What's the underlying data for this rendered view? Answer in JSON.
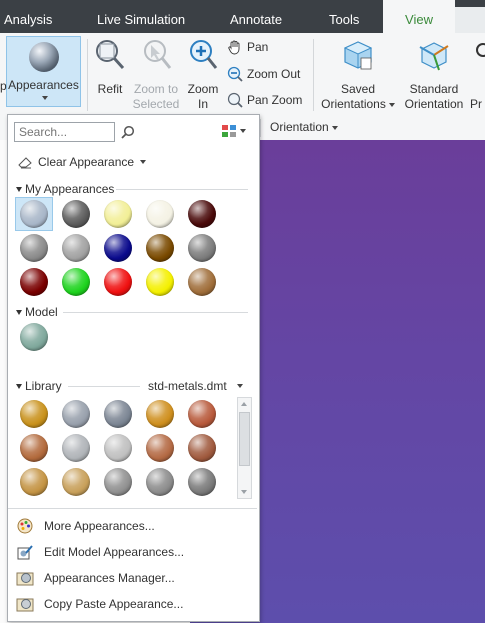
{
  "tabs": [
    {
      "label": "Analysis",
      "active": false
    },
    {
      "label": "Live Simulation",
      "active": false
    },
    {
      "label": "Annotate",
      "active": false
    },
    {
      "label": "Tools",
      "active": false
    },
    {
      "label": "View",
      "active": true
    }
  ],
  "ribbon": {
    "appearances_label": "Appearances",
    "refit_label": "Refit",
    "zoom_selected_line1": "Zoom to",
    "zoom_selected_line2": "Selected",
    "zoom_in_line1": "Zoom",
    "zoom_in_line2": "In",
    "pan_label": "Pan",
    "zoom_out_label": "Zoom Out",
    "pan_zoom_label": "Pan Zoom",
    "saved_orientations_line1": "Saved",
    "saved_orientations_line2": "Orientations",
    "standard_orientation_line1": "Standard",
    "standard_orientation_line2": "Orientation",
    "partial_left_button": "Pr",
    "partial_left_group": "p",
    "orientation_group_label": "Orientation"
  },
  "panel": {
    "search_placeholder": "Search...",
    "clear_appearance_label": "Clear Appearance",
    "my_appearances_title": "My Appearances",
    "model_title": "Model",
    "library_title": "Library",
    "library_source": "std-metals.dmt",
    "my_appearances_colors": [
      [
        "#a8b6c8",
        "#5c5c5c",
        "#f2ef96",
        "#f4f2e4",
        "#4a0a0a"
      ],
      [
        "#8a8a8a",
        "#a2a2a2",
        "#0a0a8c",
        "#7a4a00",
        "#7c7c7c"
      ],
      [
        "#7a0000",
        "#1ed31e",
        "#f01010",
        "#f4f000",
        "#a06e3a"
      ]
    ],
    "model_colors": [
      "#7fa89c"
    ],
    "library_colors": [
      [
        "#c9921c",
        "#98a0ac",
        "#7c8694",
        "#cf8f1e",
        "#b85a3c"
      ],
      [
        "#b26a3c",
        "#b0b4b8",
        "#c0c0c0",
        "#b46a44",
        "#a05a3e"
      ],
      [
        "#c49444",
        "#c8a05a",
        "#909090",
        "#8c8c8c",
        "#7a7a7a"
      ]
    ],
    "menu": [
      {
        "label": "More Appearances...",
        "icon": "palette-icon"
      },
      {
        "label": "Edit Model Appearances...",
        "icon": "edit-appearance-icon"
      },
      {
        "label": "Appearances Manager...",
        "icon": "appearances-manager-icon"
      },
      {
        "label": "Copy Paste Appearance...",
        "icon": "copy-paste-appearance-icon"
      }
    ]
  }
}
